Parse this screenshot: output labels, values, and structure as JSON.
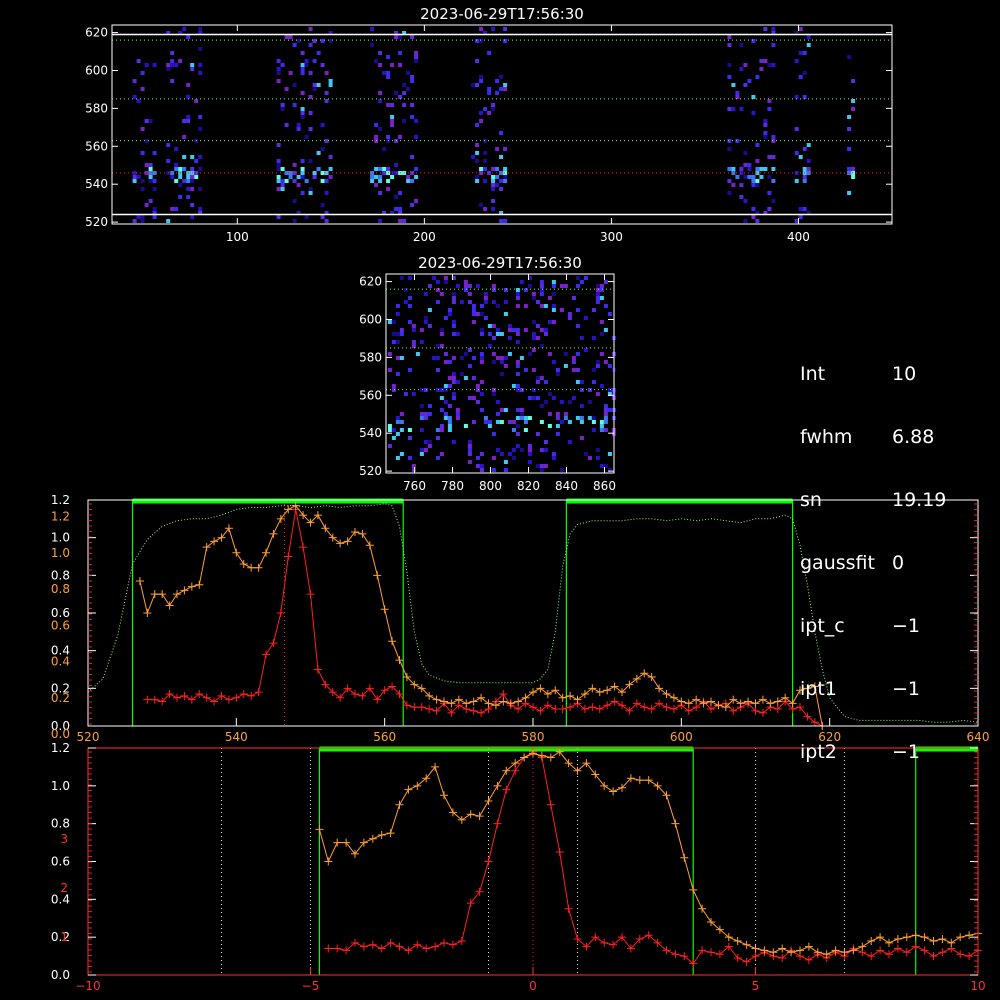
{
  "colors": {
    "green": "#00ff00",
    "orange": "#ffa033",
    "red": "#ff2020",
    "white": "#ffffff",
    "axis_red": "#ff3030",
    "dotted_green": "#70ff70"
  },
  "params": [
    {
      "key": "Int",
      "value": "10"
    },
    {
      "key": "fwhm",
      "value": "6.88"
    },
    {
      "key": "sn",
      "value": "19.19"
    },
    {
      "key": "gaussfit",
      "value": "0"
    },
    {
      "key": "ipt_c",
      "value": "−1"
    },
    {
      "key": "ipt1",
      "value": "−1"
    },
    {
      "key": "ipt2",
      "value": "−1"
    }
  ],
  "chart_data": [
    {
      "id": "top-image",
      "type": "heatmap",
      "title": "2023-06-29T17:56:30",
      "xlim": [
        33,
        450
      ],
      "ylim": [
        519,
        624
      ],
      "xticks": [
        "100",
        "200",
        "300",
        "400"
      ],
      "xtick_values": [
        100,
        200,
        300,
        400
      ],
      "yticks": [
        "520",
        "540",
        "560",
        "580",
        "600",
        "620"
      ],
      "ytick_values": [
        520,
        540,
        560,
        580,
        600,
        620
      ],
      "columns": [
        [
          44,
          55
        ],
        [
          62,
          80
        ],
        [
          121,
          149
        ],
        [
          171,
          195
        ],
        [
          225,
          243
        ],
        [
          362,
          386
        ],
        [
          398,
          405
        ],
        [
          426,
          430
        ]
      ],
      "white_lines_y": [
        524,
        619
      ],
      "dotted_lines_y": [
        616,
        585,
        563,
        546
      ]
    },
    {
      "id": "mid-image",
      "type": "heatmap",
      "title": "2023-06-29T17:56:30",
      "xlim": [
        745,
        865
      ],
      "ylim": [
        519,
        624
      ],
      "xticks": [
        "760",
        "780",
        "800",
        "820",
        "840",
        "860"
      ],
      "xtick_values": [
        760,
        780,
        800,
        820,
        840,
        860
      ],
      "yticks": [
        "520",
        "540",
        "560",
        "580",
        "600",
        "620"
      ],
      "ytick_values": [
        520,
        540,
        560,
        580,
        600,
        620
      ],
      "dotted_lines_y": [
        616,
        585,
        563
      ]
    },
    {
      "id": "profile-top",
      "type": "line",
      "xlim": [
        520,
        640
      ],
      "ylim": [
        0,
        1.2
      ],
      "xticks": [
        "520",
        "540",
        "560",
        "580",
        "600",
        "620",
        "640"
      ],
      "xtick_values": [
        520,
        540,
        560,
        580,
        600,
        620,
        640
      ],
      "yticks_white": [
        "0.0",
        "0.2",
        "0.4",
        "0.6",
        "0.8",
        "1.0",
        "1.2"
      ],
      "yticks_white_values": [
        0,
        0.2,
        0.4,
        0.6,
        0.8,
        1.0,
        1.2
      ],
      "yticks_orange": [
        "0.0",
        "0.2",
        "0.4",
        "0.6",
        "0.8",
        "1.0",
        "1.2"
      ],
      "green_bars": [
        [
          526,
          562.5
        ],
        [
          584.5,
          615
        ]
      ],
      "center_line_x": 546.5,
      "series": [
        {
          "x": [
            528,
            529,
            530,
            531,
            532,
            533,
            534,
            535,
            536,
            537,
            538,
            539,
            540,
            541,
            542,
            543,
            544,
            545,
            546,
            547,
            548,
            549,
            550,
            551,
            552,
            553,
            554,
            555,
            556,
            557,
            558,
            559,
            560,
            561,
            562,
            563,
            564,
            565,
            566,
            567,
            568,
            569,
            570,
            571,
            572,
            573,
            574,
            575,
            576,
            577,
            578,
            579,
            580,
            581,
            582,
            583,
            584,
            585,
            586,
            587,
            588,
            589,
            590,
            591,
            592,
            593,
            594,
            595,
            596,
            597,
            598,
            599,
            600,
            601,
            602,
            603,
            604,
            605,
            606,
            607,
            608,
            609,
            610,
            611,
            612,
            613,
            614,
            615,
            616,
            617,
            618,
            619
          ],
          "values": [
            0.14,
            0.14,
            0.13,
            0.17,
            0.15,
            0.16,
            0.14,
            0.17,
            0.15,
            0.13,
            0.16,
            0.14,
            0.15,
            0.17,
            0.16,
            0.18,
            0.38,
            0.44,
            0.6,
            0.9,
            1.15,
            0.95,
            0.7,
            0.3,
            0.22,
            0.18,
            0.15,
            0.2,
            0.17,
            0.16,
            0.2,
            0.14,
            0.19,
            0.21,
            0.17,
            0.11,
            0.1,
            0.1,
            0.09,
            0.08,
            0.12,
            0.07,
            0.11,
            0.09,
            0.08,
            0.07,
            0.09,
            0.13,
            0.17,
            0.11,
            0.09,
            0.12,
            0.1,
            0.08,
            0.11,
            0.09,
            0.09,
            0.1,
            0.12,
            0.09,
            0.1,
            0.09,
            0.11,
            0.13,
            0.11,
            0.08,
            0.12,
            0.1,
            0.09,
            0.12,
            0.1,
            0.09,
            0.11,
            0.08,
            0.1,
            0.13,
            0.09,
            0.11,
            0.12,
            0.08,
            0.1,
            0.12,
            0.08,
            0.07,
            0.1,
            0.09,
            0.13,
            0.09,
            0.1,
            0.05,
            0.02,
            0.0
          ]
        },
        {
          "x": [
            527,
            528,
            529,
            530,
            531,
            532,
            533,
            534,
            535,
            536,
            537,
            538,
            539,
            540,
            541,
            542,
            543,
            544,
            545,
            546,
            547,
            548,
            549,
            550,
            551,
            552,
            553,
            554,
            555,
            556,
            557,
            558,
            559,
            560,
            561,
            562,
            563,
            564,
            565,
            566,
            567,
            568,
            569,
            570,
            571,
            572,
            573,
            574,
            575,
            576,
            577,
            578,
            579,
            580,
            581,
            582,
            583,
            584,
            585,
            586,
            587,
            588,
            589,
            590,
            591,
            592,
            593,
            594,
            595,
            596,
            597,
            598,
            599,
            600,
            601,
            602,
            603,
            604,
            605,
            606,
            607,
            608,
            609,
            610,
            611,
            612,
            613,
            614,
            615,
            616,
            617,
            618,
            619
          ],
          "values": [
            0.77,
            0.6,
            0.7,
            0.7,
            0.64,
            0.7,
            0.72,
            0.74,
            0.75,
            0.95,
            0.98,
            1.0,
            1.05,
            0.92,
            0.86,
            0.84,
            0.84,
            0.92,
            1.02,
            1.1,
            1.15,
            1.17,
            1.12,
            1.08,
            1.12,
            1.05,
            1.0,
            0.97,
            0.98,
            1.03,
            1.02,
            0.96,
            0.8,
            0.62,
            0.45,
            0.35,
            0.26,
            0.22,
            0.2,
            0.16,
            0.14,
            0.13,
            0.12,
            0.14,
            0.12,
            0.13,
            0.15,
            0.12,
            0.11,
            0.13,
            0.12,
            0.13,
            0.15,
            0.18,
            0.2,
            0.17,
            0.19,
            0.15,
            0.16,
            0.14,
            0.17,
            0.2,
            0.18,
            0.19,
            0.21,
            0.18,
            0.22,
            0.25,
            0.28,
            0.26,
            0.2,
            0.17,
            0.15,
            0.13,
            0.12,
            0.14,
            0.12,
            0.13,
            0.11,
            0.1,
            0.14,
            0.12,
            0.13,
            0.12,
            0.14,
            0.12,
            0.13,
            0.15,
            0.12,
            0.19,
            0.2,
            0.21,
            0.0
          ]
        },
        {
          "x": [
            520,
            522,
            524,
            526,
            528,
            530,
            532,
            534,
            536,
            538,
            540,
            542,
            544,
            546,
            548,
            550,
            552,
            554,
            556,
            558,
            560,
            561,
            562,
            563,
            564,
            565,
            566,
            568,
            570,
            572,
            574,
            576,
            578,
            580,
            581,
            582,
            583,
            584,
            585,
            586,
            588,
            590,
            592,
            594,
            596,
            598,
            600,
            602,
            604,
            606,
            608,
            610,
            612,
            614,
            615,
            616,
            617,
            618,
            619,
            620,
            621,
            622,
            624,
            626,
            628,
            630,
            632,
            634,
            636,
            638,
            640
          ],
          "values": [
            0.18,
            0.25,
            0.48,
            0.86,
            0.99,
            1.06,
            1.09,
            1.1,
            1.1,
            1.12,
            1.15,
            1.16,
            1.16,
            1.17,
            1.17,
            1.16,
            1.17,
            1.16,
            1.17,
            1.17,
            1.18,
            1.17,
            1.06,
            0.82,
            0.5,
            0.33,
            0.27,
            0.24,
            0.23,
            0.23,
            0.23,
            0.23,
            0.23,
            0.23,
            0.25,
            0.3,
            0.5,
            0.85,
            1.02,
            1.07,
            1.09,
            1.09,
            1.09,
            1.1,
            1.1,
            1.09,
            1.1,
            1.09,
            1.1,
            1.09,
            1.08,
            1.1,
            1.1,
            1.12,
            1.1,
            0.96,
            0.75,
            0.5,
            0.3,
            0.15,
            0.1,
            0.05,
            0.03,
            0.03,
            0.03,
            0.03,
            0.03,
            0.02,
            0.02,
            0.03,
            0.02
          ]
        }
      ]
    },
    {
      "id": "profile-bottom",
      "type": "line",
      "xlim": [
        -10,
        10
      ],
      "ylim": [
        0,
        1.2
      ],
      "xticks": [
        "−10",
        "−5",
        "0",
        "5",
        "10"
      ],
      "xtick_values": [
        -10,
        -5,
        0,
        5,
        10
      ],
      "yticks_white": [
        "0.0",
        "0.2",
        "0.4",
        "0.6",
        "0.8",
        "1.0",
        "1.2"
      ],
      "yticks_white_values": [
        0,
        0.2,
        0.4,
        0.6,
        0.8,
        1.0,
        1.2
      ],
      "yticks_red": [
        "1",
        "2",
        "3"
      ],
      "yticks_red_values": [
        0.2,
        0.46,
        0.72
      ],
      "green_bars": [
        [
          -4.8,
          3.6
        ],
        [
          8.6,
          10
        ]
      ],
      "center_line_x": 0,
      "dotted_white_x": [
        -7,
        -5,
        -1,
        1,
        5,
        7
      ],
      "series": [
        {
          "x": [
            -4.6,
            -4.4,
            -4.2,
            -4.0,
            -3.8,
            -3.6,
            -3.4,
            -3.2,
            -3.0,
            -2.8,
            -2.6,
            -2.4,
            -2.2,
            -2.0,
            -1.8,
            -1.6,
            -1.4,
            -1.2,
            -1.0,
            -0.8,
            -0.6,
            -0.4,
            -0.2,
            0.0,
            0.2,
            0.4,
            0.6,
            0.8,
            1.0,
            1.2,
            1.4,
            1.6,
            1.8,
            2.0,
            2.2,
            2.4,
            2.6,
            2.8,
            3.0,
            3.2,
            3.4,
            3.6,
            3.8,
            4.0,
            4.2,
            4.4,
            4.6,
            4.8,
            5.0,
            5.2,
            5.4,
            5.6,
            5.8,
            6.0,
            6.2,
            6.4,
            6.6,
            6.8,
            7.0,
            7.2,
            7.4,
            7.6,
            7.8,
            8.0,
            8.2,
            8.4,
            8.6,
            8.8,
            9.0,
            9.2,
            9.4,
            9.6,
            9.8,
            10.0
          ],
          "values": [
            0.14,
            0.14,
            0.13,
            0.17,
            0.15,
            0.16,
            0.14,
            0.17,
            0.15,
            0.13,
            0.16,
            0.14,
            0.15,
            0.17,
            0.16,
            0.18,
            0.38,
            0.44,
            0.6,
            0.8,
            0.98,
            1.08,
            1.15,
            1.18,
            1.15,
            0.9,
            0.65,
            0.35,
            0.19,
            0.15,
            0.2,
            0.17,
            0.16,
            0.2,
            0.14,
            0.19,
            0.21,
            0.17,
            0.13,
            0.11,
            0.1,
            0.06,
            0.13,
            0.12,
            0.11,
            0.15,
            0.09,
            0.07,
            0.1,
            0.12,
            0.1,
            0.09,
            0.13,
            0.1,
            0.08,
            0.11,
            0.09,
            0.12,
            0.1,
            0.14,
            0.12,
            0.1,
            0.13,
            0.11,
            0.14,
            0.12,
            0.15,
            0.13,
            0.1,
            0.12,
            0.14,
            0.11,
            0.1,
            0.13
          ]
        },
        {
          "x": [
            -4.8,
            -4.6,
            -4.4,
            -4.2,
            -4.0,
            -3.8,
            -3.6,
            -3.4,
            -3.2,
            -3.0,
            -2.8,
            -2.6,
            -2.4,
            -2.2,
            -2.0,
            -1.8,
            -1.6,
            -1.4,
            -1.2,
            -1.0,
            -0.8,
            -0.6,
            -0.4,
            -0.2,
            0.0,
            0.2,
            0.4,
            0.6,
            0.8,
            1.0,
            1.2,
            1.4,
            1.6,
            1.8,
            2.0,
            2.2,
            2.4,
            2.6,
            2.8,
            3.0,
            3.2,
            3.4,
            3.6,
            3.8,
            4.0,
            4.2,
            4.4,
            4.6,
            4.8,
            5.0,
            5.2,
            5.4,
            5.6,
            5.8,
            6.0,
            6.2,
            6.4,
            6.6,
            6.8,
            7.0,
            7.2,
            7.4,
            7.6,
            7.8,
            8.0,
            8.2,
            8.4,
            8.6,
            8.8,
            9.0,
            9.2,
            9.4,
            9.6,
            9.8,
            10.0
          ],
          "values": [
            0.77,
            0.6,
            0.7,
            0.7,
            0.64,
            0.7,
            0.72,
            0.74,
            0.75,
            0.9,
            0.98,
            1.0,
            1.04,
            1.1,
            0.95,
            0.86,
            0.82,
            0.85,
            0.84,
            0.92,
            1.0,
            1.08,
            1.12,
            1.15,
            1.17,
            1.16,
            1.15,
            1.18,
            1.12,
            1.08,
            1.12,
            1.06,
            1.0,
            0.97,
            0.99,
            1.04,
            1.03,
            1.03,
            1.0,
            0.95,
            0.8,
            0.62,
            0.45,
            0.35,
            0.28,
            0.24,
            0.2,
            0.18,
            0.16,
            0.14,
            0.13,
            0.12,
            0.14,
            0.12,
            0.13,
            0.15,
            0.12,
            0.11,
            0.13,
            0.12,
            0.13,
            0.15,
            0.18,
            0.2,
            0.17,
            0.19,
            0.2,
            0.21,
            0.2,
            0.18,
            0.19,
            0.17,
            0.2,
            0.21,
            0.22
          ]
        }
      ]
    }
  ]
}
